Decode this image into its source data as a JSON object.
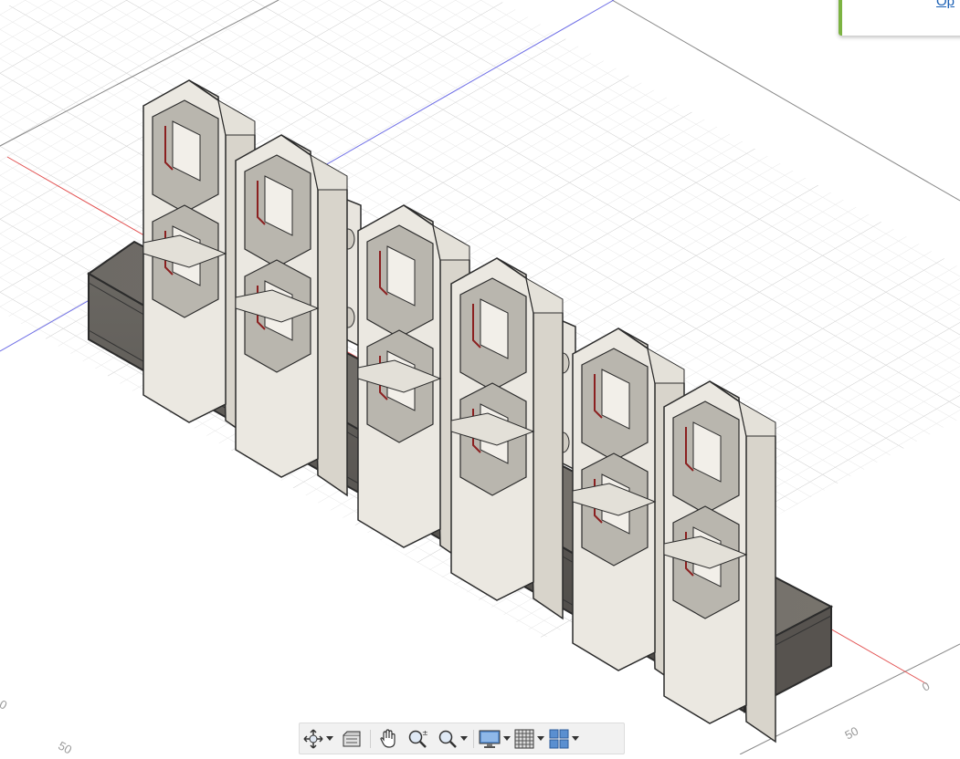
{
  "notification": {
    "link_text": "Op"
  },
  "axis_labels": {
    "origin": "0",
    "tick_50_right": "50",
    "tick_50_left": "50",
    "tick_0_left": "0"
  },
  "colors": {
    "grid": "#e6e6e6",
    "x_axis": "#e25050",
    "y_axis": "#6f6fe6",
    "body": "#e3e0d8",
    "base": "#5b5854",
    "wire": "#8b2020"
  },
  "toolbar": {
    "items": [
      {
        "icon": "orbit-icon",
        "dropdown": true
      },
      {
        "icon": "look-at-icon",
        "dropdown": false
      },
      {
        "icon": "pan-hand-icon",
        "dropdown": false
      },
      {
        "icon": "zoom-icon",
        "dropdown": false
      },
      {
        "icon": "zoom-window-icon",
        "dropdown": true
      },
      {
        "icon": "display-settings-icon",
        "dropdown": true
      },
      {
        "icon": "grid-settings-icon",
        "dropdown": true
      },
      {
        "icon": "viewports-icon",
        "dropdown": true
      }
    ]
  }
}
